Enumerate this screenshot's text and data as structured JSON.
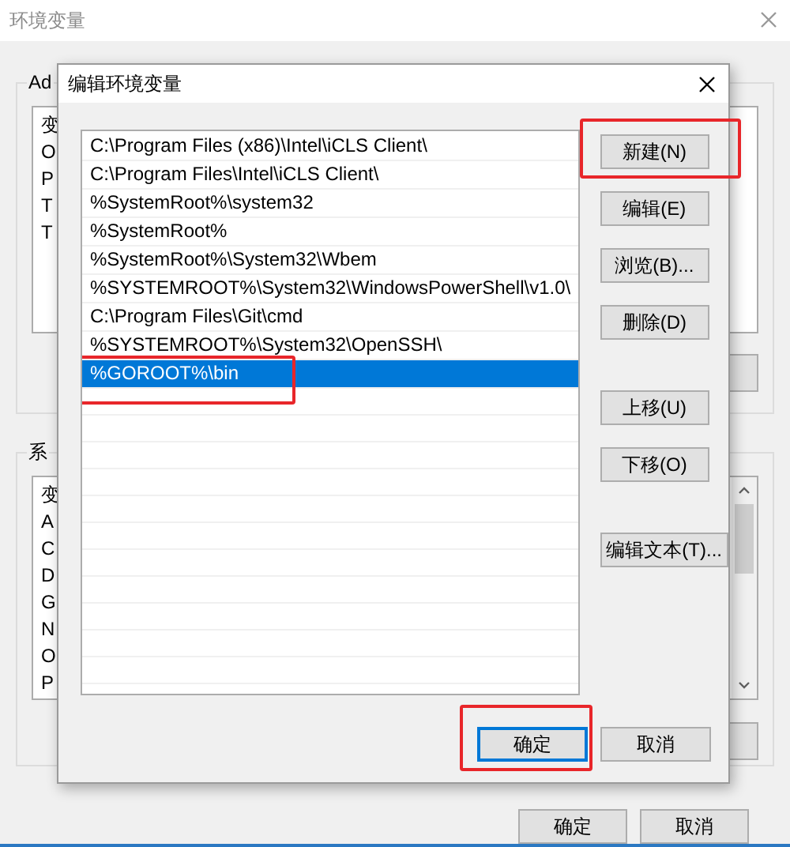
{
  "background_window": {
    "title": "环境变量",
    "user_group": {
      "label": "Ad",
      "items": [
        "变",
        "O",
        "P",
        "T",
        "T"
      ]
    },
    "system_group": {
      "label": "系",
      "items": [
        "变",
        "A",
        "C",
        "D",
        "G",
        "N",
        "O",
        "P"
      ]
    },
    "buttons": [
      "确定",
      "取消"
    ]
  },
  "dialog": {
    "title": "编辑环境变量",
    "paths": [
      {
        "text": "C:\\Program Files (x86)\\Intel\\iCLS Client\\",
        "selected": false,
        "highlighted": false
      },
      {
        "text": "C:\\Program Files\\Intel\\iCLS Client\\",
        "selected": false,
        "highlighted": false
      },
      {
        "text": "%SystemRoot%\\system32",
        "selected": false,
        "highlighted": false
      },
      {
        "text": "%SystemRoot%",
        "selected": false,
        "highlighted": false
      },
      {
        "text": "%SystemRoot%\\System32\\Wbem",
        "selected": false,
        "highlighted": false
      },
      {
        "text": "%SYSTEMROOT%\\System32\\WindowsPowerShell\\v1.0\\",
        "selected": false,
        "highlighted": false
      },
      {
        "text": "C:\\Program Files\\Git\\cmd",
        "selected": false,
        "highlighted": false
      },
      {
        "text": "%SYSTEMROOT%\\System32\\OpenSSH\\",
        "selected": false,
        "highlighted": false
      },
      {
        "text": "%GOROOT%\\bin",
        "selected": true,
        "highlighted": true
      }
    ],
    "side_button_groups": [
      {
        "buttons": [
          {
            "label": "新建(N)",
            "highlighted": true
          },
          {
            "label": "编辑(E)",
            "highlighted": false
          },
          {
            "label": "浏览(B)...",
            "highlighted": false
          },
          {
            "label": "删除(D)",
            "highlighted": false
          }
        ]
      },
      {
        "buttons": [
          {
            "label": "上移(U)",
            "highlighted": false
          },
          {
            "label": "下移(O)",
            "highlighted": false
          }
        ]
      },
      {
        "buttons": [
          {
            "label": "编辑文本(T)...",
            "highlighted": false
          }
        ]
      }
    ],
    "buttons": [
      {
        "label": "确定",
        "default": true,
        "highlighted": true
      },
      {
        "label": "取消",
        "default": false,
        "highlighted": false
      }
    ]
  }
}
